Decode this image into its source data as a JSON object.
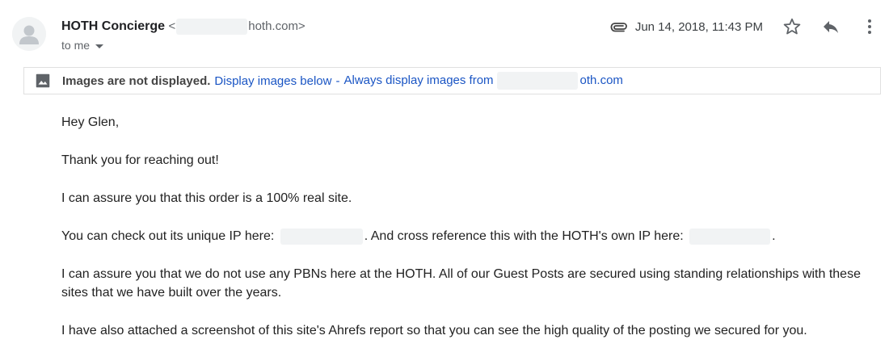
{
  "header": {
    "sender_name": "HOTH Concierge",
    "sender_email_prefix": "<",
    "sender_email_domain": "hoth.com>",
    "recipient_label": "to me",
    "date": "Jun 14, 2018, 11:43 PM"
  },
  "icons": {
    "avatar": "person-avatar-icon",
    "attachment": "paperclip-icon",
    "star": "star-outline-icon",
    "reply": "reply-arrow-icon",
    "more": "vertical-dots-icon",
    "image": "image-placeholder-icon",
    "recipient_dropdown": "chevron-down-icon"
  },
  "images_notice": {
    "bold_text": "Images are not displayed.",
    "display_below": "Display images below",
    "separator": "-",
    "always_display_prefix": "Always display images from",
    "always_display_domain": "oth.com"
  },
  "body": {
    "greeting": "Hey Glen,",
    "p1": "Thank you for reaching out!",
    "p2": "I can assure you that this order is a 100% real site.",
    "p3_a": "You can check out its unique IP here:",
    "p3_b": ". And cross reference this with the HOTH's own IP here:",
    "p3_c": ".",
    "p4": "I can assure you that we do not use any PBNs here at the HOTH. All of our Guest Posts are secured using standing relationships with these sites that we have built over the years.",
    "p5": "I have also attached a screenshot of this site's Ahrefs report so that you can see the high quality of the posting we secured for you."
  },
  "colors": {
    "link": "#1a55c4",
    "text": "#222222",
    "muted": "#5f6368",
    "redaction": "#f1f3f4",
    "border": "#e0e0e0"
  }
}
